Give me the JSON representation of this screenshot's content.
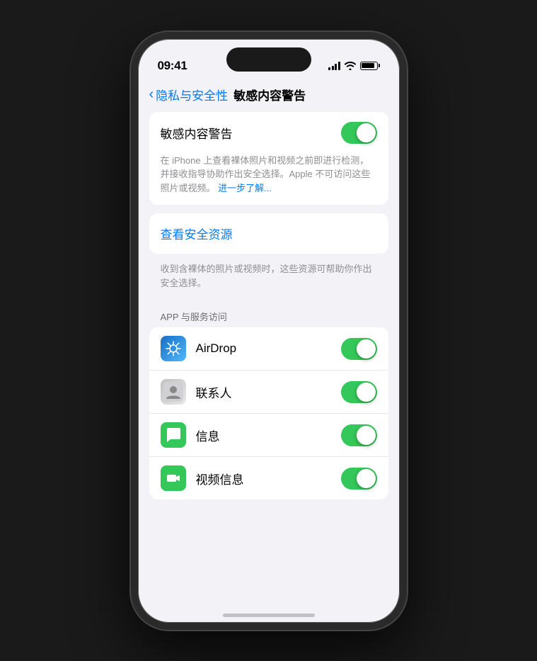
{
  "statusBar": {
    "time": "09:41"
  },
  "navBar": {
    "backLabel": "隐私与安全性",
    "title": "敏感内容警告"
  },
  "mainToggle": {
    "label": "敏感内容警告",
    "state": true
  },
  "description": {
    "text": "在 iPhone 上查看裸体照片和视频之前即进行检测，并接收指导协助作出安全选择。Apple 不可访问这些照片或视频。",
    "linkText": "进一步了解..."
  },
  "safetySection": {
    "linkLabel": "查看安全资源",
    "description": "收到含裸体的照片或视频时，这些资源可帮助你作出安全选择。"
  },
  "appSection": {
    "header": "APP 与服务访问",
    "apps": [
      {
        "name": "AirDrop",
        "iconType": "airdrop",
        "toggleOn": true
      },
      {
        "name": "联系人",
        "iconType": "contacts",
        "toggleOn": true
      },
      {
        "name": "信息",
        "iconType": "messages",
        "toggleOn": true
      },
      {
        "name": "视频信息",
        "iconType": "facetime",
        "toggleOn": true
      }
    ]
  }
}
